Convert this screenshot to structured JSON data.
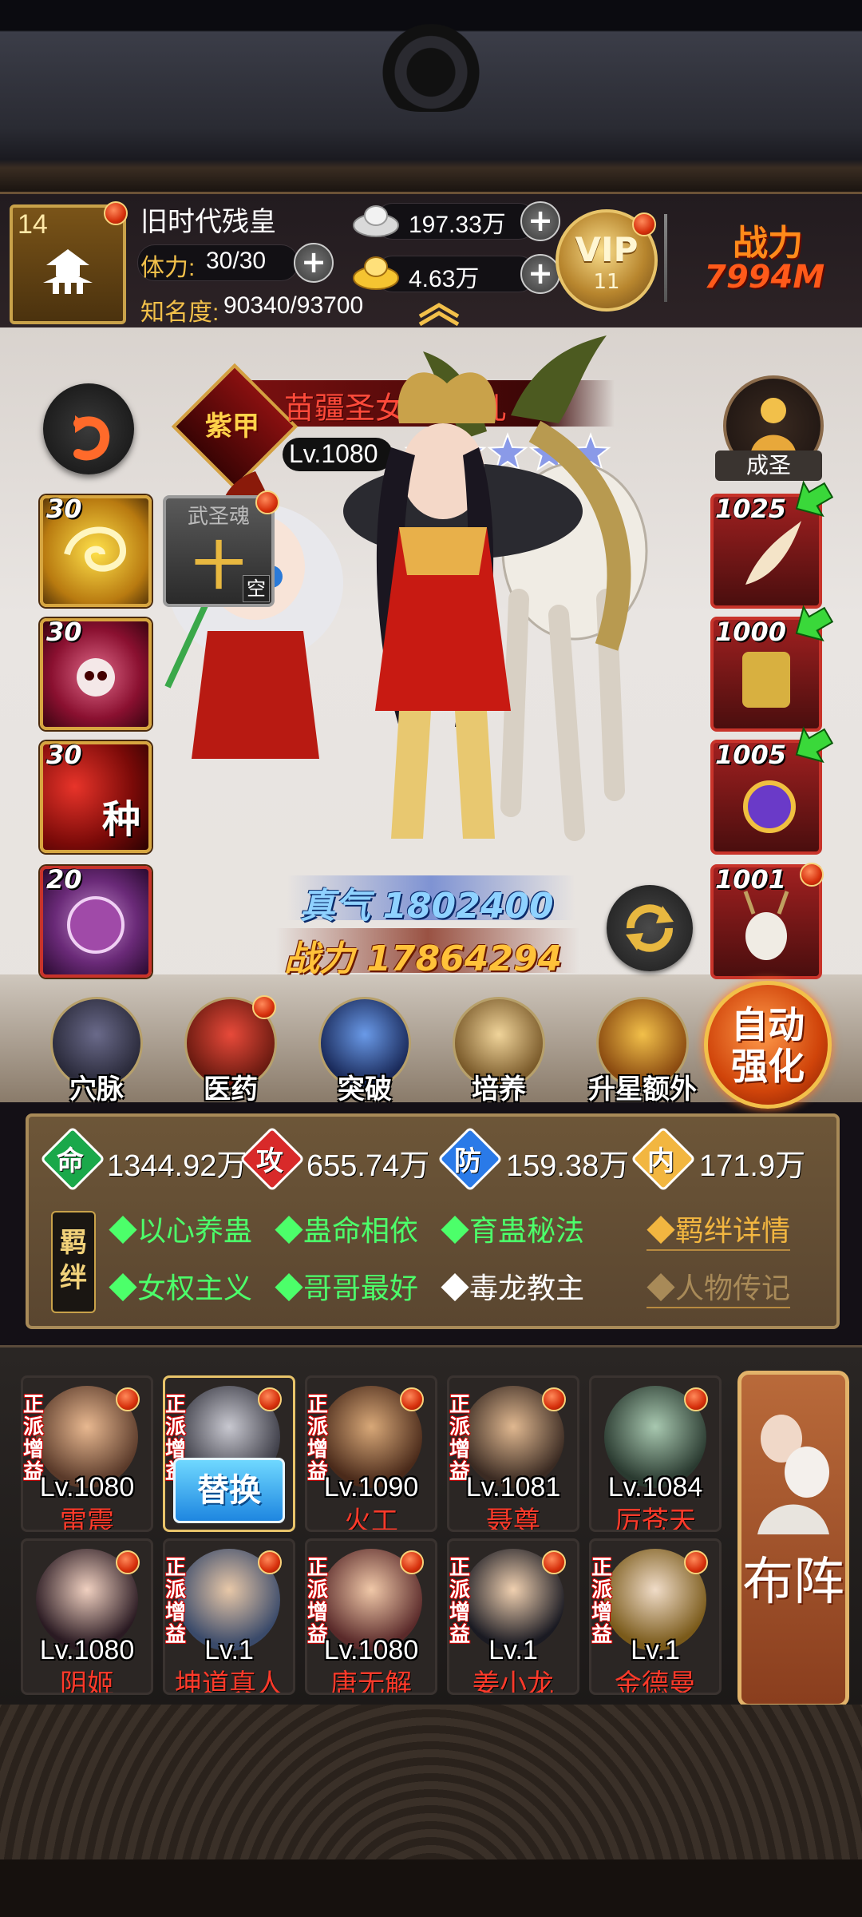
{
  "player": {
    "level": "14",
    "name": "旧时代残皇",
    "stamina_label": "体力:",
    "stamina_value": "30/30",
    "fame_label": "知名度:",
    "fame_value": "90340/93700",
    "silver": "197.33万",
    "gold": "4.63万",
    "vip_label": "VIP",
    "vip_level": "11",
    "power_label": "战力",
    "power_value": "7994M"
  },
  "hero": {
    "name": "苗疆圣女·蓝凰儿",
    "rank_badge": "紫甲",
    "level": "Lv.1080",
    "stars": 5,
    "achievement": "成圣",
    "true_qi": "真气 1802400",
    "power": "战力 17864294"
  },
  "skills": [
    {
      "level": "30"
    },
    {
      "level": "30"
    },
    {
      "level": "30",
      "mark": "种"
    },
    {
      "level": "20"
    }
  ],
  "soul_slot": {
    "label": "武圣魂",
    "value": "十",
    "tag": "空"
  },
  "equipment": [
    {
      "level": "1025"
    },
    {
      "level": "1000"
    },
    {
      "level": "1005"
    },
    {
      "level": "1001"
    }
  ],
  "features": [
    "穴脉",
    "医药",
    "突破",
    "培养",
    "升星额外"
  ],
  "auto_strengthen": "自动强化",
  "stats": {
    "hp_label": "命",
    "hp": "1344.92万",
    "atk_label": "攻",
    "atk": "655.74万",
    "def_label": "防",
    "def": "159.38万",
    "int_label": "内",
    "int": "171.9万"
  },
  "bonds": {
    "title": "羁绊",
    "items": [
      "以心养蛊",
      "蛊命相依",
      "育蛊秘法",
      "女权主义",
      "哥哥最好",
      "毒龙教主"
    ],
    "detail_link": "羁绊详情",
    "bio_link": "人物传记"
  },
  "roster": [
    {
      "tag": "正派增益",
      "level": "Lv.1080",
      "name": "雷震"
    },
    {
      "tag": "正派增益",
      "level": "",
      "name": "",
      "button": "替换"
    },
    {
      "tag": "正派增益",
      "level": "Lv.1090",
      "name": "火工"
    },
    {
      "tag": "正派增益",
      "level": "Lv.1081",
      "name": "聂尊"
    },
    {
      "tag": "",
      "level": "Lv.1084",
      "name": "厉苍天"
    },
    {
      "tag": "",
      "level": "Lv.1080",
      "name": "阴姬"
    },
    {
      "tag": "正派增益",
      "level": "Lv.1",
      "name": "坤道真人"
    },
    {
      "tag": "正派增益",
      "level": "Lv.1080",
      "name": "唐无解"
    },
    {
      "tag": "正派增益",
      "level": "Lv.1",
      "name": "姜小龙"
    },
    {
      "tag": "正派增益",
      "level": "Lv.1",
      "name": "金德曼"
    }
  ],
  "formation_button": "布阵",
  "colors": {
    "gold": "#d7a640",
    "red": "#c8332a",
    "green_bond": "#4cff6a",
    "orange_link": "#f2b640"
  }
}
